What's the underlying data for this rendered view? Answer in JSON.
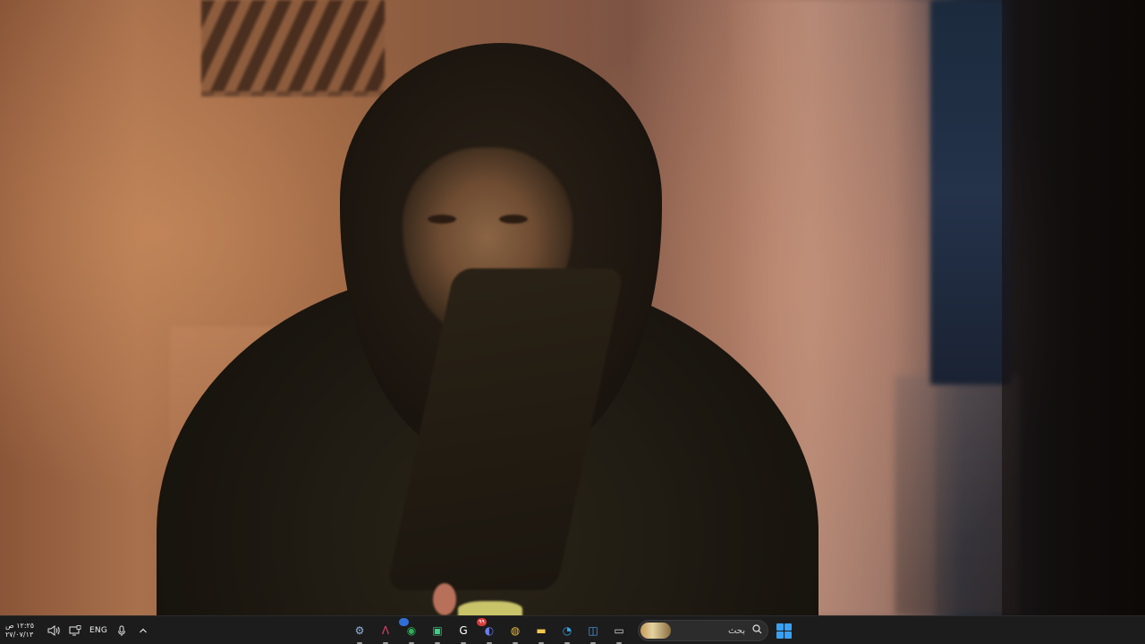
{
  "taskbar": {
    "clock": {
      "time": "١٢:٢٥ ص",
      "date": "٢٧/٠٧/١٣"
    },
    "language": "ENG",
    "search": {
      "placeholder": "بحث"
    },
    "tray_icons": [
      "volume-icon",
      "display-icon",
      "microphone-icon",
      "show-hidden-icons-chevron"
    ],
    "apps": [
      {
        "name": "settings-icon",
        "glyph": "⚙",
        "color": "#8fb4e0"
      },
      {
        "name": "app-a-icon",
        "glyph": "Λ",
        "color": "#e0406a"
      },
      {
        "name": "browser-shield-icon",
        "glyph": "◉",
        "color": "#2fb05a",
        "badge": ""
      },
      {
        "name": "android-app-icon",
        "glyph": "▣",
        "color": "#3cd184"
      },
      {
        "name": "g-app-icon",
        "glyph": "G",
        "color": "#ffffff"
      },
      {
        "name": "discord-icon",
        "glyph": "◐",
        "color": "#6d7df0",
        "badge": "٩٩"
      },
      {
        "name": "chrome-icon",
        "glyph": "◍",
        "color": "#e8b73a"
      },
      {
        "name": "file-explorer-icon",
        "glyph": "▬",
        "color": "#f2c94c"
      },
      {
        "name": "edge-icon",
        "glyph": "◔",
        "color": "#35a6e8"
      },
      {
        "name": "store-icon",
        "glyph": "◫",
        "color": "#4aa3f0"
      },
      {
        "name": "task-view-icon",
        "glyph": "▭",
        "color": "#d8d8d8"
      }
    ]
  }
}
